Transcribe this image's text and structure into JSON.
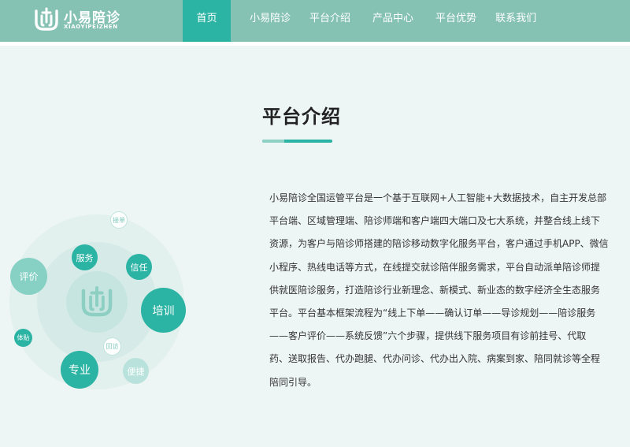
{
  "brand": {
    "name_cn": "小易陪诊",
    "name_en": "XIAOYIPEIZHEN",
    "color_primary": "#2bb3a3",
    "color_header": "#86c2b4"
  },
  "nav": {
    "items": [
      {
        "label": "首页",
        "active": true
      },
      {
        "label": "小易陪诊",
        "active": false
      },
      {
        "label": "平台介绍",
        "active": false
      },
      {
        "label": "产品中心",
        "active": false
      },
      {
        "label": "平台优势",
        "active": false
      },
      {
        "label": "联系我们",
        "active": false
      }
    ]
  },
  "section": {
    "title": "平台介绍",
    "paragraph_lines": [
      "小易陪诊全国运管平台是一个基于互联网+人工智能+大数据技术，自主开发总部",
      "平台端、区域管理端、陪诊师端和客户端四大端口及七大系统，并整合线上线下",
      "资源，为客户与陪诊师搭建的陪诊移动数字化服务平台，客户通过手机APP、微信",
      "小程序、热线电话等方式，在线提交就诊陪伴服务需求，平台自动派单陪诊师提",
      "供就医陪诊服务，打造陪诊行业新理念、新模式、新业态的数字经济全生态服务",
      "平台。平台基本框架流程为“线上下单——确认订单——导诊规划——陪诊服务",
      "——客户评价——系统反馈”六个步骤，提供线下服务项目有诊前挂号、代取",
      "药、送取报告、代办跑腿、代办问诊、代办出入院、病案到家、陪同就诊等全程",
      "陪同引导。"
    ]
  },
  "diagram": {
    "bubbles": {
      "jiedan": "接单",
      "fuwu": "服务",
      "xinren": "信任",
      "pingjia": "评价",
      "peixun": "培训",
      "tiejie": "体贴",
      "huifang": "回访",
      "zhuanye": "专业",
      "bianjie": "便捷"
    }
  }
}
